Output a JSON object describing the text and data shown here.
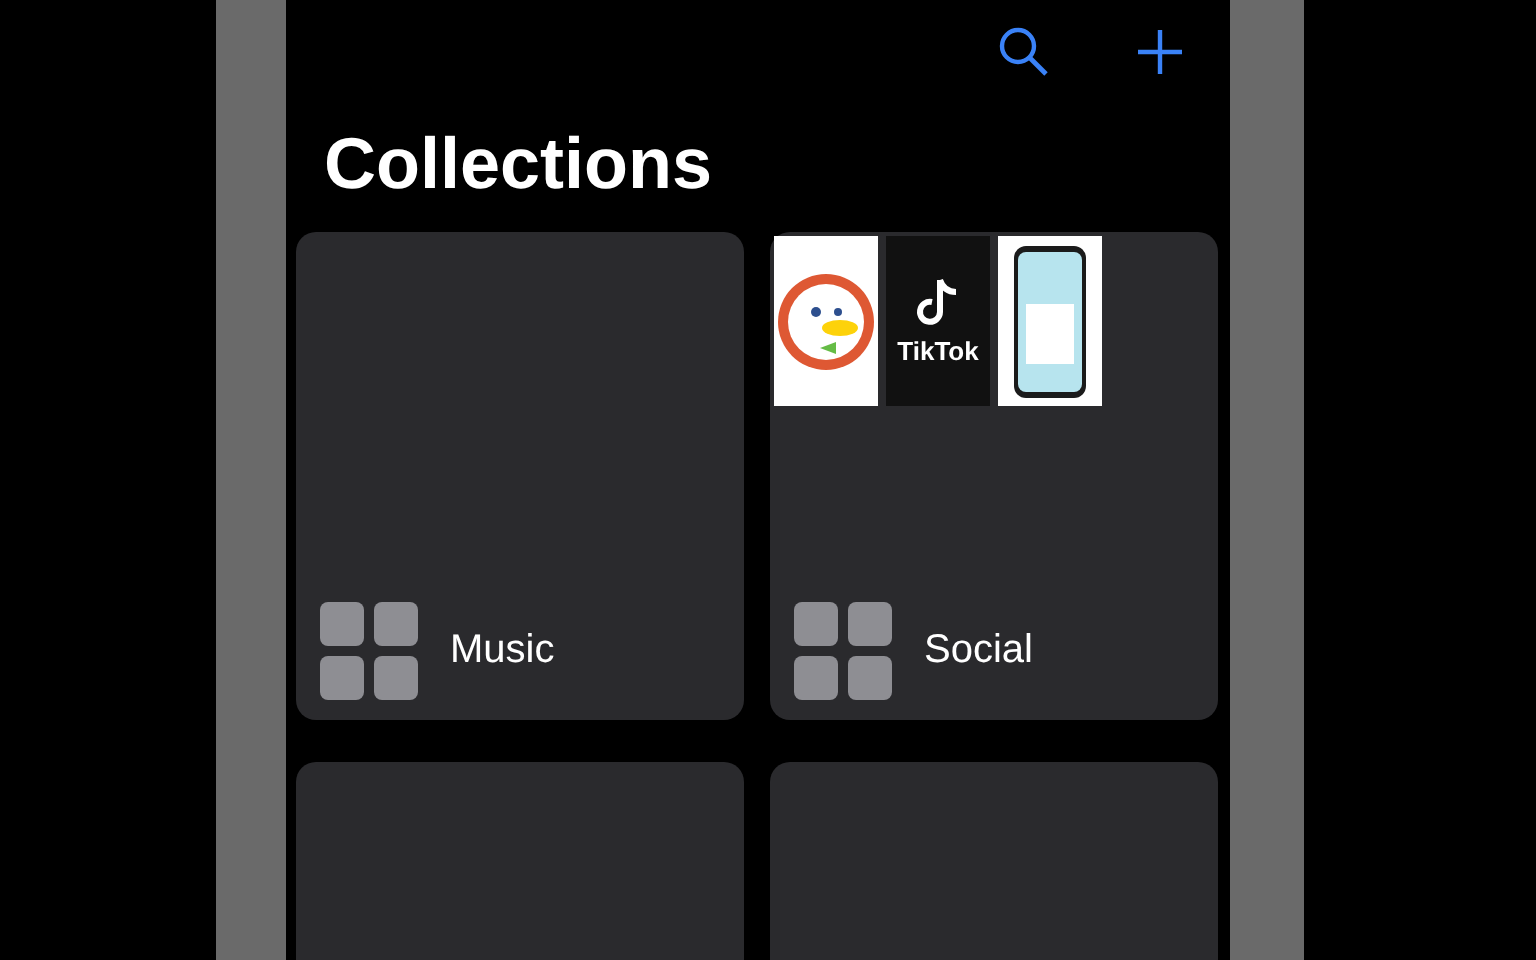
{
  "title": "Collections",
  "collections": [
    {
      "kind": "full",
      "name": "Music"
    },
    {
      "kind": "full",
      "name": "Social",
      "thumbnails": [
        {
          "kind": "duck"
        },
        {
          "kind": "logo",
          "label": "TikTok"
        },
        {
          "kind": "screenshot"
        }
      ]
    },
    {
      "kind": "cut"
    },
    {
      "kind": "cut"
    }
  ]
}
